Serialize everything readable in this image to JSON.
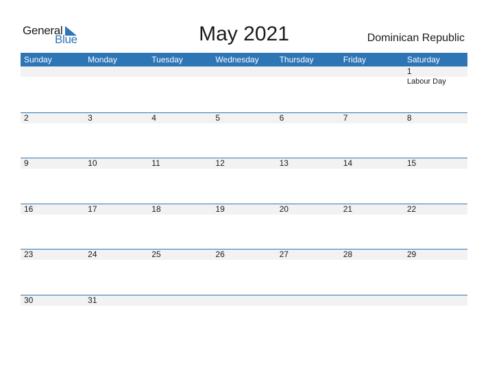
{
  "logo": {
    "line1": "General",
    "line2": "Blue"
  },
  "title": "May 2021",
  "country": "Dominican Republic",
  "colors": {
    "accent": "#2e75b6",
    "strip": "#f2f2f2"
  },
  "weekdays": [
    "Sunday",
    "Monday",
    "Tuesday",
    "Wednesday",
    "Thursday",
    "Friday",
    "Saturday"
  ],
  "weeks": [
    {
      "days": [
        "",
        "",
        "",
        "",
        "",
        "",
        "1"
      ],
      "events": [
        "",
        "",
        "",
        "",
        "",
        "",
        "Labour Day"
      ]
    },
    {
      "days": [
        "2",
        "3",
        "4",
        "5",
        "6",
        "7",
        "8"
      ],
      "events": [
        "",
        "",
        "",
        "",
        "",
        "",
        ""
      ]
    },
    {
      "days": [
        "9",
        "10",
        "11",
        "12",
        "13",
        "14",
        "15"
      ],
      "events": [
        "",
        "",
        "",
        "",
        "",
        "",
        ""
      ]
    },
    {
      "days": [
        "16",
        "17",
        "18",
        "19",
        "20",
        "21",
        "22"
      ],
      "events": [
        "",
        "",
        "",
        "",
        "",
        "",
        ""
      ]
    },
    {
      "days": [
        "23",
        "24",
        "25",
        "26",
        "27",
        "28",
        "29"
      ],
      "events": [
        "",
        "",
        "",
        "",
        "",
        "",
        ""
      ]
    },
    {
      "days": [
        "30",
        "31",
        "",
        "",
        "",
        "",
        ""
      ],
      "events": [
        "",
        "",
        "",
        "",
        "",
        "",
        ""
      ]
    }
  ]
}
